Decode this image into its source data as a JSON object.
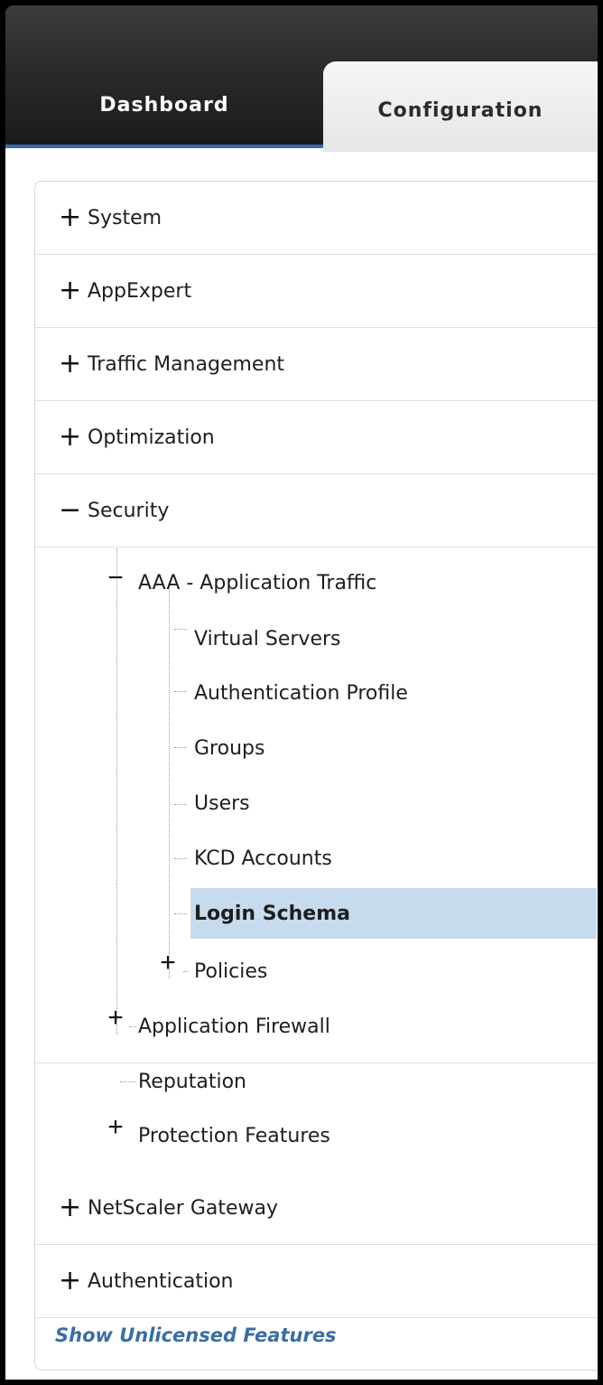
{
  "tabs": {
    "dashboard": "Dashboard",
    "configuration": "Configuration"
  },
  "nav": {
    "system": "System",
    "appexpert": "AppExpert",
    "traffic_management": "Traffic Management",
    "optimization": "Optimization",
    "security": "Security",
    "security_children": {
      "aaa": "AAA - Application Traffic",
      "aaa_children": {
        "virtual_servers": "Virtual Servers",
        "authentication_profile": "Authentication Profile",
        "groups": "Groups",
        "users": "Users",
        "kcd_accounts": "KCD Accounts",
        "login_schema": "Login Schema",
        "policies": "Policies"
      },
      "application_firewall": "Application Firewall",
      "reputation": "Reputation",
      "protection_features": "Protection Features"
    },
    "netscaler_gateway": "NetScaler Gateway",
    "authentication": "Authentication",
    "show_unlicensed": "Show Unlicensed Features"
  },
  "icons": {
    "expand": "+",
    "collapse": "−"
  },
  "colors": {
    "accent": "#3a68b0",
    "selection": "#c7dbee",
    "link": "#3a6ea5"
  }
}
